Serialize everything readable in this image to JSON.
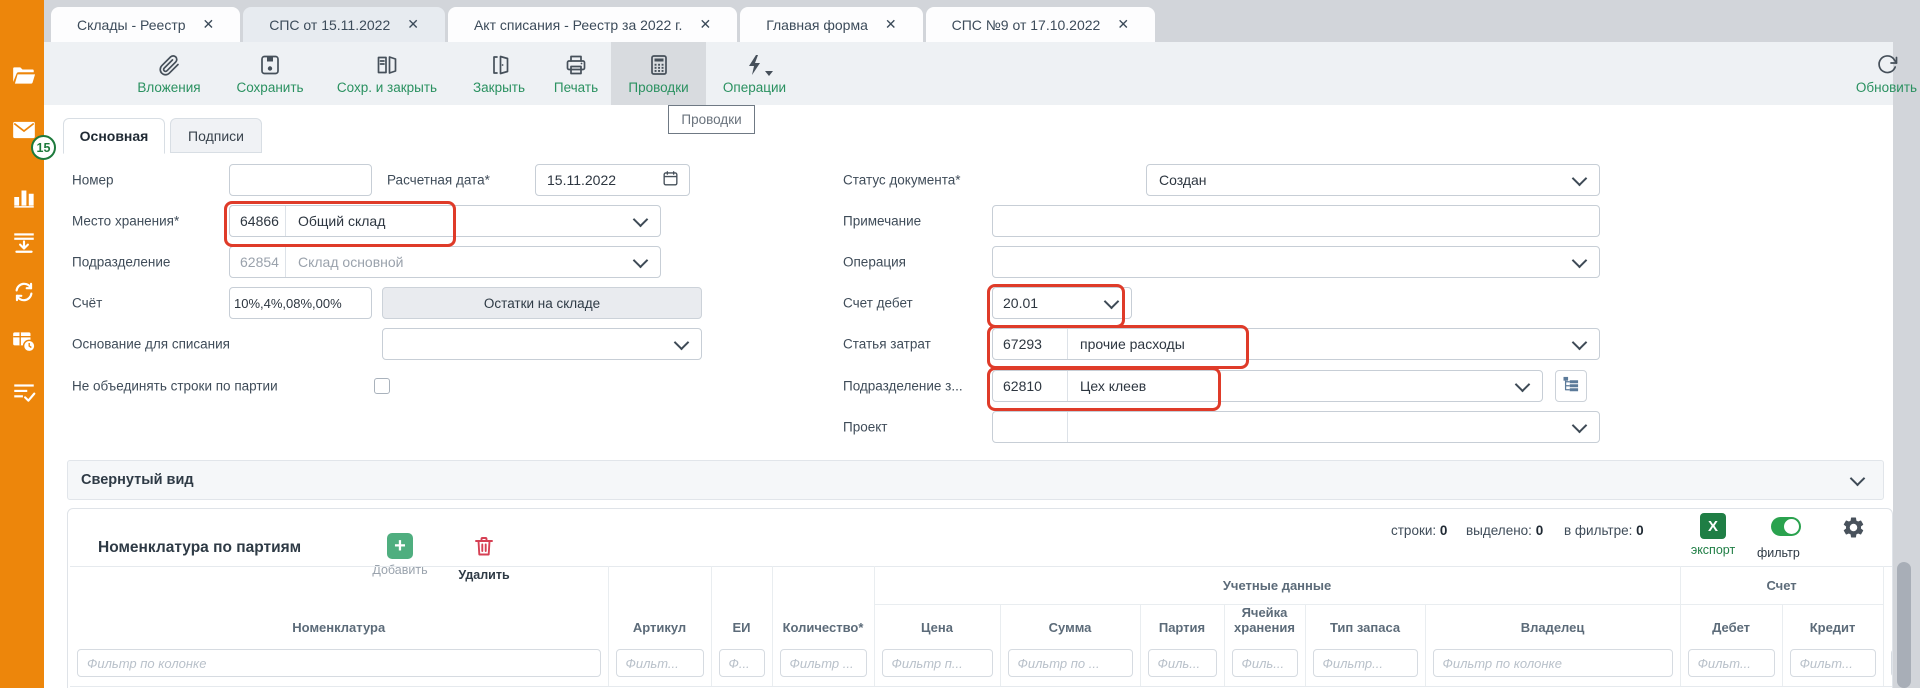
{
  "sidebar": {
    "badge_count": "15",
    "icons": [
      "folder-open",
      "mail",
      "bar-chart",
      "list-download",
      "sync",
      "table-clock",
      "list-check"
    ]
  },
  "tabbar": {
    "close_glyph": "✕",
    "tabs": [
      {
        "label": "Склады - Реестр"
      },
      {
        "label": "СПС от 15.11.2022"
      },
      {
        "label": "Акт списания - Реестр за 2022 г."
      },
      {
        "label": "Главная форма"
      },
      {
        "label": "СПС №9 от 17.10.2022"
      }
    ]
  },
  "toolbar": {
    "attachments": "Вложения",
    "save": "Сохранить",
    "save_close": "Сохр. и закрыть",
    "close": "Закрыть",
    "print": "Печать",
    "postings": "Проводки",
    "operations": "Операции",
    "refresh": "Обновить",
    "tooltip": "Проводки"
  },
  "subtabs": {
    "main": "Основная",
    "signatures": "Подписи"
  },
  "form": {
    "left": {
      "number_label": "Номер",
      "number_value": "",
      "calc_date_label": "Расчетная дата*",
      "calc_date_value": "15.11.2022",
      "storage_label": "Место хранения*",
      "storage_code": "64866",
      "storage_name": "Общий склад",
      "department_label": "Подразделение",
      "department_code": "62854",
      "department_name": "Склад основной",
      "account_label": "Счёт",
      "account_value": "10%,4%,08%,00%",
      "stock_button": "Остатки на складе",
      "writeoff_basis_label": "Основание для списания",
      "no_merge_label": "Не объединять строки по партии"
    },
    "right": {
      "status_label": "Статус документа*",
      "status_value": "Создан",
      "note_label": "Примечание",
      "note_value": "",
      "operation_label": "Операция",
      "debit_label": "Счет дебет",
      "debit_value": "20.01",
      "cost_item_label": "Статья затрат",
      "cost_item_code": "67293",
      "cost_item_name": "прочие расходы",
      "cost_dept_label": "Подразделение з...",
      "cost_dept_code": "62810",
      "cost_dept_name": "Цех клеев",
      "project_label": "Проект"
    },
    "highlight_color": "#df3b29"
  },
  "collapse_bar": {
    "label": "Свернутый вид"
  },
  "grid": {
    "title": "Номенклатура по партиям",
    "add_label": "Добавить",
    "add_glyph": "+",
    "delete_label": "Удалить",
    "counters": {
      "rows_label": "строки:",
      "rows": "0",
      "selected_label": "выделено:",
      "selected": "0",
      "in_filter_label": "в фильтре:",
      "in_filter": "0"
    },
    "export_label": "экспорт",
    "export_glyph": "X",
    "filter_label": "фильтр",
    "groups": {
      "accounting": "Учетные данные",
      "account": "Счет"
    },
    "columns": [
      {
        "label": "Номенклатура",
        "filter": "Фильтр по колонке"
      },
      {
        "label": "Артикул",
        "filter": "Фильт..."
      },
      {
        "label": "ЕИ",
        "filter": "Ф..."
      },
      {
        "label": "Количество*",
        "filter": "Фильтр ..."
      },
      {
        "label": "Цена",
        "filter": "Фильтр п..."
      },
      {
        "label": "Сумма",
        "filter": "Фильтр по ..."
      },
      {
        "label": "Партия",
        "filter": "Филь..."
      },
      {
        "label": "Ячейка хранения",
        "filter": "Филь..."
      },
      {
        "label": "Тип запаса",
        "filter": "Фильтр..."
      },
      {
        "label": "Владелец",
        "filter": "Фильтр по колонке"
      },
      {
        "label": "Дебет",
        "filter": "Фильт..."
      },
      {
        "label": "Кредит",
        "filter": "Фильт..."
      }
    ]
  }
}
